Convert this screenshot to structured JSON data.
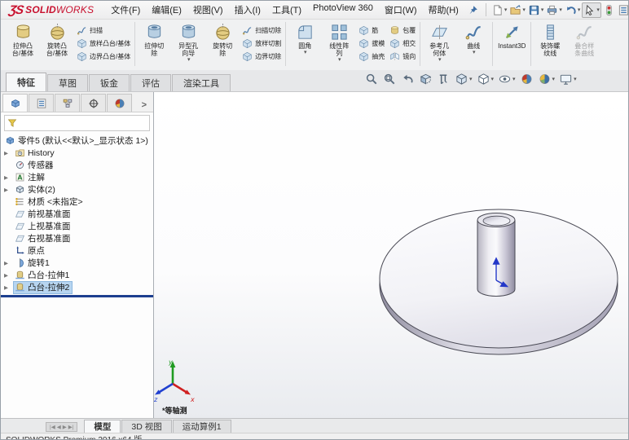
{
  "colors": {
    "logo_red": "#c8102e",
    "selection": "#b7d5f0",
    "rollback_bar": "#1d3f8f",
    "accent_blue": "#2f6fb0"
  },
  "menu_bar": {
    "logo": {
      "mark": "ƷS",
      "name_bold": "SOLID",
      "name_light": "WORKS"
    },
    "items": [
      "文件(F)",
      "编辑(E)",
      "视图(V)",
      "插入(I)",
      "工具(T)",
      "PhotoView 360",
      "窗口(W)",
      "帮助(H)"
    ],
    "quick_access": [
      {
        "id": "new-document",
        "caret": true
      },
      {
        "id": "open",
        "caret": true
      },
      {
        "id": "save",
        "caret": true
      },
      {
        "id": "print",
        "caret": true
      },
      {
        "id": "undo",
        "caret": true
      },
      {
        "id": "select",
        "caret": true,
        "boxed": true
      },
      {
        "id": "rebuild",
        "caret": false
      },
      {
        "id": "file-properties",
        "caret": false
      },
      {
        "id": "options",
        "caret": true
      },
      {
        "id": "overflow",
        "caret": false
      }
    ]
  },
  "ribbon": {
    "groups": [
      {
        "buttons": [
          {
            "type": "large",
            "id": "extruded-boss-base",
            "icon": "extrude-boss",
            "lines": [
              "拉伸凸",
              "台/基体"
            ]
          },
          {
            "type": "large",
            "id": "revolved-boss-base",
            "icon": "revolve-boss",
            "lines": [
              "旋转凸",
              "台/基体"
            ]
          },
          {
            "type": "stack",
            "items": [
              {
                "id": "swept-boss",
                "icon": "sweep",
                "label": "扫描"
              },
              {
                "id": "lofted-boss",
                "icon": "loft-boss",
                "label": "放样凸台/基体"
              },
              {
                "id": "boundary-boss",
                "icon": "boundary-boss",
                "label": "边界凸台/基体"
              }
            ]
          }
        ]
      },
      {
        "buttons": [
          {
            "type": "large",
            "id": "extruded-cut",
            "icon": "extrude-cut",
            "lines": [
              "拉伸切",
              "除"
            ]
          },
          {
            "type": "large",
            "id": "hole-wizard",
            "icon": "hole-wizard",
            "lines": [
              "异型孔",
              "向导"
            ],
            "caret": true
          },
          {
            "type": "large",
            "id": "revolved-cut",
            "icon": "revolve-cut",
            "lines": [
              "旋转切",
              "除"
            ]
          },
          {
            "type": "stack",
            "items": [
              {
                "id": "swept-cut",
                "icon": "sweep-cut",
                "label": "扫描切除"
              },
              {
                "id": "lofted-cut",
                "icon": "loft-cut",
                "label": "放样切割"
              },
              {
                "id": "boundary-cut",
                "icon": "boundary-cut",
                "label": "边界切除"
              }
            ]
          }
        ]
      },
      {
        "buttons": [
          {
            "type": "large",
            "id": "fillet",
            "icon": "fillet",
            "lines": [
              "圆角"
            ],
            "caret": true
          },
          {
            "type": "large",
            "id": "linear-pattern",
            "icon": "linear-pattern",
            "lines": [
              "线性阵",
              "列"
            ],
            "caret": true
          },
          {
            "type": "stack",
            "items": [
              {
                "id": "rib",
                "icon": "rib",
                "label": "筋"
              },
              {
                "id": "draft",
                "icon": "draft",
                "label": "拔模"
              },
              {
                "id": "shell",
                "icon": "shell",
                "label": "抽壳"
              }
            ]
          },
          {
            "type": "stack",
            "items": [
              {
                "id": "wrap",
                "icon": "wrap",
                "label": "包覆"
              },
              {
                "id": "intersect",
                "icon": "intersect",
                "label": "相交"
              },
              {
                "id": "mirror",
                "icon": "mirror",
                "label": "镜向"
              }
            ]
          }
        ]
      },
      {
        "buttons": [
          {
            "type": "large",
            "id": "reference-geometry",
            "icon": "reference-geometry",
            "lines": [
              "参考几",
              "何体"
            ],
            "caret": true
          },
          {
            "type": "large",
            "id": "curves",
            "icon": "curves",
            "lines": [
              "曲线"
            ],
            "caret": true
          }
        ]
      },
      {
        "buttons": [
          {
            "type": "large",
            "id": "instant3d",
            "icon": "instant3d",
            "lines": [
              "Instant3D"
            ]
          }
        ]
      },
      {
        "buttons": [
          {
            "type": "large",
            "id": "cosmetic-thread",
            "icon": "cosmetic-thread",
            "lines": [
              "装饰螺",
              "纹线"
            ]
          },
          {
            "type": "large",
            "id": "composite-curve",
            "icon": "composite-curve",
            "lines": [
              "叠合样",
              "条曲线"
            ],
            "disabled": true
          }
        ]
      }
    ]
  },
  "command_tabs": {
    "items": [
      "特征",
      "草图",
      "钣金",
      "评估",
      "渲染工具"
    ],
    "active_index": 0
  },
  "headsup": {
    "items": [
      {
        "id": "zoom-to-fit"
      },
      {
        "id": "zoom-to-area"
      },
      {
        "id": "previous-view"
      },
      {
        "id": "section-view"
      },
      {
        "id": "measure"
      },
      {
        "id": "view-orientation",
        "caret": true
      },
      {
        "id": "display-style",
        "caret": true
      },
      {
        "id": "hide-show-items",
        "caret": true
      },
      {
        "id": "edit-appearance"
      },
      {
        "id": "apply-scene",
        "caret": true
      },
      {
        "id": "view-settings",
        "caret": true
      }
    ]
  },
  "panel": {
    "expand_label": ">",
    "tabs": [
      {
        "id": "feature-manager",
        "active": true
      },
      {
        "id": "property-manager"
      },
      {
        "id": "configuration-manager"
      },
      {
        "id": "dimxpert-manager"
      },
      {
        "id": "display-manager"
      }
    ],
    "tree": {
      "items": [
        {
          "id": "part-root",
          "icon": "part",
          "label": "零件5 (默认<<默认>_显示状态 1>)",
          "root": true
        },
        {
          "id": "history",
          "icon": "history",
          "label": "History",
          "expandable": true
        },
        {
          "id": "sensors",
          "icon": "sensors",
          "label": "传感器"
        },
        {
          "id": "annotations",
          "icon": "annotations",
          "label": "注解",
          "expandable": true
        },
        {
          "id": "solid-bodies",
          "icon": "bodies",
          "label": "实体(2)",
          "expandable": true
        },
        {
          "id": "material",
          "icon": "material",
          "label": "材质 <未指定>"
        },
        {
          "id": "front-plane",
          "icon": "plane",
          "label": "前视基准面"
        },
        {
          "id": "top-plane",
          "icon": "plane",
          "label": "上视基准面"
        },
        {
          "id": "right-plane",
          "icon": "plane",
          "label": "右视基准面"
        },
        {
          "id": "origin",
          "icon": "origin",
          "label": "原点"
        },
        {
          "id": "revolve1",
          "icon": "revolve",
          "label": "旋转1",
          "expandable": true
        },
        {
          "id": "boss-extrude1",
          "icon": "extrude",
          "label": "凸台-拉伸1",
          "expandable": true
        },
        {
          "id": "boss-extrude2",
          "icon": "extrude",
          "label": "凸台-拉伸2",
          "expandable": true,
          "selected": true
        }
      ]
    }
  },
  "viewport": {
    "view_label": "*等轴测",
    "triad": {
      "x": "x",
      "y": "y",
      "z": "z"
    }
  },
  "bottom_tabs": {
    "nav": [
      "|◀",
      "◀",
      "▶",
      "▶|"
    ],
    "items": [
      "模型",
      "3D 视图",
      "运动算例1"
    ],
    "active_index": 0
  },
  "status_bar": {
    "text": "SOLIDWORKS Premium 2016 x64 版"
  }
}
